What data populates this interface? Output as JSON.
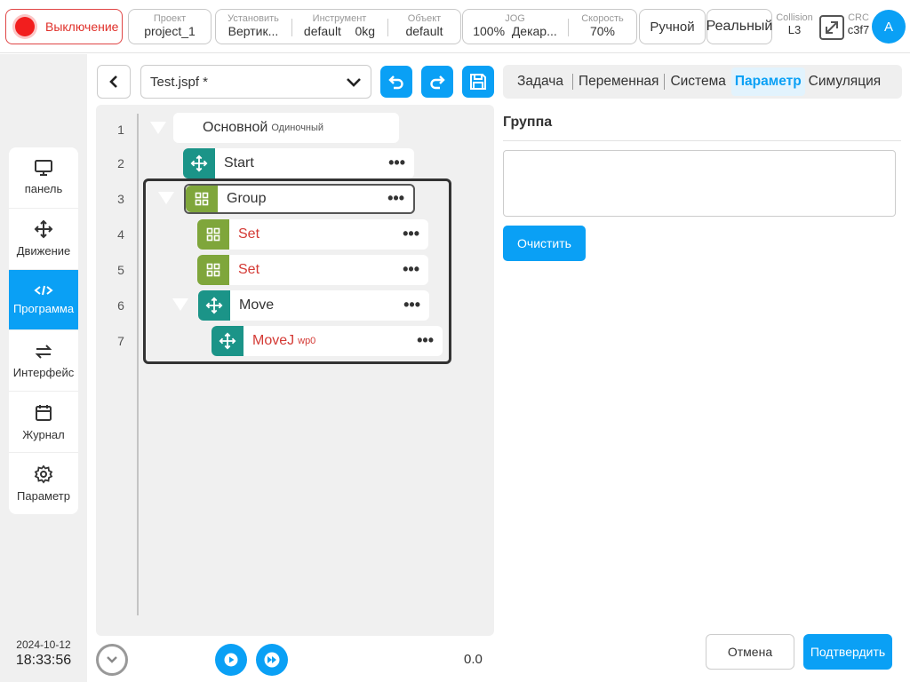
{
  "topbar": {
    "power_label": "Выключение",
    "project": {
      "caption": "Проект",
      "value": "project_1"
    },
    "install": {
      "caption": "Установить",
      "value": "Вертик..."
    },
    "tool": {
      "caption": "Инструмент",
      "value": "default",
      "extra": "0kg"
    },
    "object": {
      "caption": "Объект",
      "value": "default"
    },
    "jog": {
      "caption": "JOG",
      "value": "100%",
      "extra": "Декар..."
    },
    "speed": {
      "caption": "Скорость",
      "value": "70%"
    },
    "mode": "Ручной",
    "env": "Реальный",
    "collision": {
      "caption": "Collision",
      "value": "L3"
    },
    "crc": {
      "caption": "CRC",
      "value": "c3f7"
    },
    "avatar": "A"
  },
  "sidebar": {
    "items": [
      {
        "label": "панель",
        "icon": "monitor-icon"
      },
      {
        "label": "Движение",
        "icon": "move-icon"
      },
      {
        "label": "Программа",
        "icon": "code-icon"
      },
      {
        "label": "Интерфейс",
        "icon": "swap-icon"
      },
      {
        "label": "Журнал",
        "icon": "calendar-icon"
      },
      {
        "label": "Параметр",
        "icon": "gear-icon"
      }
    ],
    "active": "Программа",
    "date": "2024-10-12",
    "time": "18:33:56"
  },
  "editor": {
    "file_name": "Test.jspf *",
    "lines": [
      "1",
      "2",
      "3",
      "4",
      "5",
      "6",
      "7"
    ],
    "nodes": [
      {
        "label": "Основной",
        "sub": "Одиночный"
      },
      {
        "label": "Start"
      },
      {
        "label": "Group"
      },
      {
        "label": "Set"
      },
      {
        "label": "Set"
      },
      {
        "label": "Move"
      },
      {
        "label": "MoveJ",
        "sub": "wp0"
      }
    ],
    "more_glyph": "•••",
    "speed_value": "0.0"
  },
  "right_panel": {
    "tabs": [
      "Задача",
      "Переменная",
      "Система",
      "Параметр",
      "Симуляция"
    ],
    "active_tab": "Параметр",
    "title": "Группа",
    "comment_value": "",
    "clear_label": "Очистить",
    "cancel_label": "Отмена",
    "confirm_label": "Подтвердить"
  },
  "colors": {
    "accent": "#0aa0f5",
    "teal": "#1b9488",
    "green": "#7fa63b",
    "error_red": "#d43a35",
    "power_red": "#f21e1e"
  }
}
